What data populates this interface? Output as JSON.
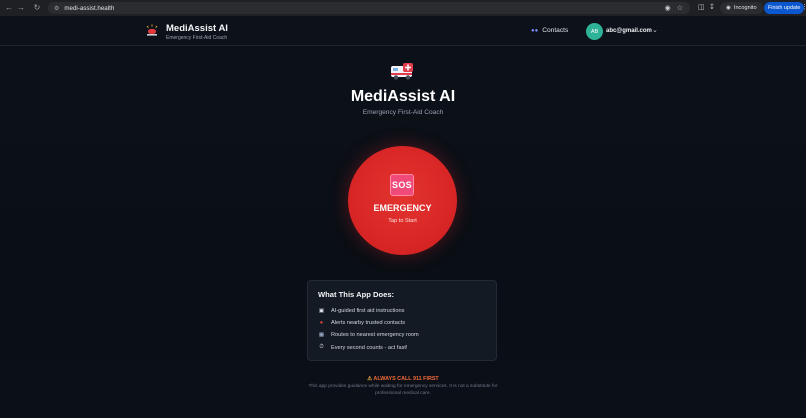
{
  "browser": {
    "url": "medi-assist.health",
    "incognito_label": "Incognito",
    "update_button": "Finish update"
  },
  "header": {
    "app_name": "MediAssist AI",
    "app_tagline": "Emergency First-Aid Coach",
    "contacts_label": "Contacts",
    "avatar_initials": "AB",
    "user_email": "abc@gmail.com"
  },
  "hero": {
    "title": "MediAssist AI",
    "subtitle": "Emergency First-Aid Coach"
  },
  "sos": {
    "badge": "SOS",
    "label": "EMERGENCY",
    "sublabel": "Tap to Start"
  },
  "features": {
    "title": "What This App Does:",
    "items": [
      {
        "icon": "ambulance-icon",
        "text": "AI-guided first aid instructions"
      },
      {
        "icon": "pin-icon",
        "text": "Alerts nearby trusted contacts"
      },
      {
        "icon": "hospital-icon",
        "text": "Routes to nearest emergency room"
      },
      {
        "icon": "stopwatch-icon",
        "text": "Every second counts - act fast!"
      }
    ]
  },
  "footer": {
    "warning": "ALWAYS CALL 911 FIRST",
    "disclaimer": "This app provides guidance while waiting for emergency services. It is not a substitute for professional medical care."
  },
  "colors": {
    "background": "#0b0f16",
    "sos_red": "#d62424",
    "sos_badge": "#f04a7a",
    "warning_orange": "#f26a38",
    "avatar_teal": "#2fb398",
    "update_blue": "#0b57d0"
  }
}
